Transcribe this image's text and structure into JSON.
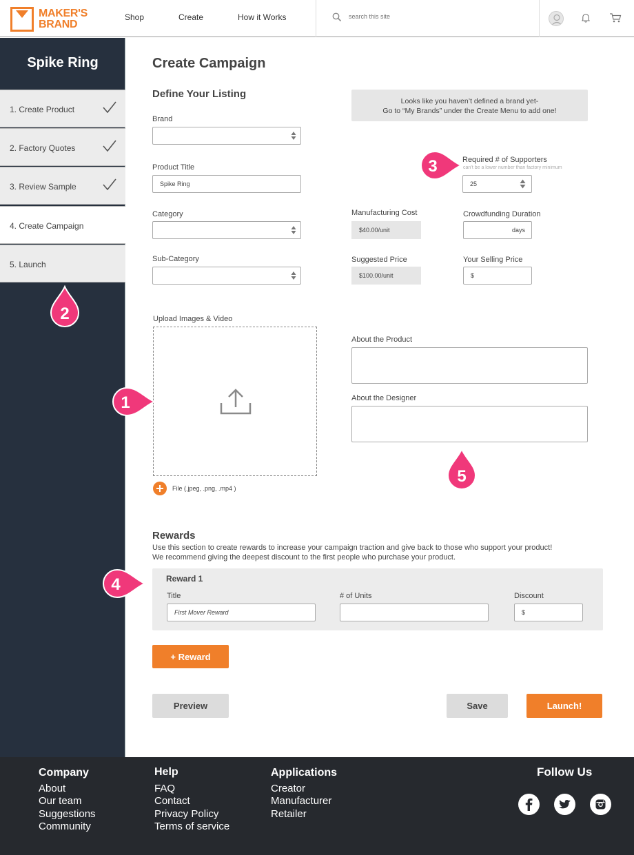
{
  "header": {
    "logo_line1": "MAKER'S",
    "logo_line2": "BRAND",
    "nav": [
      "Shop",
      "Create",
      "How it Works"
    ],
    "search_placeholder": "search this site",
    "icons": [
      "search-icon",
      "user-icon",
      "bell-icon",
      "cart-icon"
    ]
  },
  "sidebar": {
    "title": "Spike Ring",
    "steps": [
      {
        "label": "1. Create Product",
        "done": true
      },
      {
        "label": "2. Factory Quotes",
        "done": true
      },
      {
        "label": "3. Review Sample",
        "done": true
      },
      {
        "label": "4. Create Campaign",
        "done": false
      },
      {
        "label": "5. Launch",
        "done": false
      }
    ]
  },
  "markers": [
    "1",
    "2",
    "3",
    "4",
    "5"
  ],
  "main": {
    "title": "Create Campaign",
    "section_title": "Define Your Listing",
    "brand_label": "Brand",
    "product_title_label": "Product Title",
    "product_title_value": "Spike Ring",
    "category_label": "Category",
    "subcategory_label": "Sub-Category",
    "notice_line1": "Looks like you haven’t defined a brand yet-",
    "notice_line2": "Go to “My Brands” under the Create Menu to add one!",
    "supporters_label": "Required # of Supporters",
    "supporters_hint": "can’t be a lower number than factory minimum",
    "supporters_value": "25",
    "manufacturing_cost_label": "Manufacturing Cost",
    "manufacturing_cost_value": "$40.00/unit",
    "crowdfunding_label": "Crowdfunding Duration",
    "crowdfunding_unit": "days",
    "suggested_price_label": "Suggested Price",
    "suggested_price_value": "$100.00/unit",
    "selling_price_label": "Your  Selling Price",
    "selling_price_value": "$",
    "upload_label": "Upload Images & Video",
    "file_types": "File (.jpeg, .png, .mp4 )",
    "about_product_label": "About the Product",
    "about_designer_label": "About the Designer"
  },
  "rewards": {
    "title": "Rewards",
    "desc_line1": "Use this section to create rewards to increase your campaign traction and give back to those who support your product!",
    "desc_line2": "We recommend giving the deepest discount to the first people who purchase your product.",
    "reward_title": "Reward 1",
    "title_label": "Title",
    "title_value": "First Mover Reward",
    "units_label": "# of Units",
    "discount_label": "Discount",
    "discount_value": "$",
    "add_reward_label": "+  Reward"
  },
  "actions": {
    "preview": "Preview",
    "save": "Save",
    "launch": "Launch!"
  },
  "footer": {
    "company_title": "Company",
    "company_links": [
      "About",
      "Our team",
      "Suggestions",
      "Community"
    ],
    "help_title": "Help",
    "help_links": [
      "FAQ",
      "Contact",
      "Privacy Policy",
      "Terms of service"
    ],
    "apps_title": "Applications",
    "apps_links": [
      "Creator",
      "Manufacturer",
      "Retailer"
    ],
    "follow_title": "Follow Us",
    "social_icons": [
      "facebook-icon",
      "twitter-icon",
      "instagram-icon"
    ]
  },
  "colors": {
    "accent": "#f07f2a",
    "sidebar_bg": "#26303e",
    "footer_bg": "#26292e",
    "marker": "#f0387a"
  }
}
